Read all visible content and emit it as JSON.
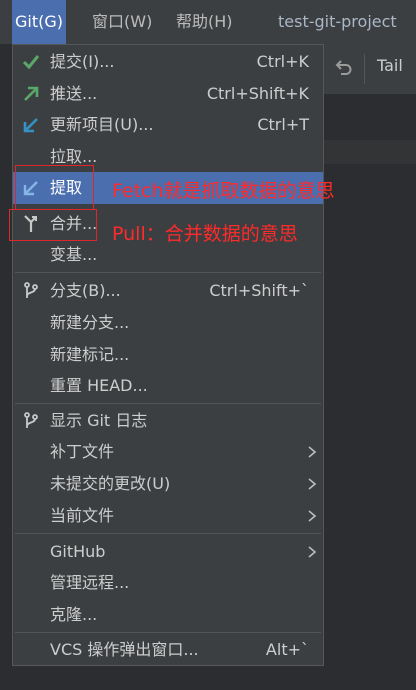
{
  "menubar": {
    "git": "Git(G)",
    "window": "窗口(W)",
    "help": "帮助(H)",
    "project": "test-git-project"
  },
  "toolbar": {
    "tail_label": "Tail"
  },
  "menu": {
    "commit": {
      "label": "提交(I)...",
      "shortcut": "Ctrl+K"
    },
    "push": {
      "label": "推送...",
      "shortcut": "Ctrl+Shift+K"
    },
    "update": {
      "label": "更新项目(U)...",
      "shortcut": "Ctrl+T"
    },
    "pull": {
      "label": "拉取..."
    },
    "fetch": {
      "label": "提取"
    },
    "merge": {
      "label": "合并..."
    },
    "rebase": {
      "label": "变基..."
    },
    "branches": {
      "label": "分支(B)...",
      "shortcut": "Ctrl+Shift+`"
    },
    "new_branch": {
      "label": "新建分支..."
    },
    "new_tag": {
      "label": "新建标记..."
    },
    "reset_head": {
      "label": "重置 HEAD..."
    },
    "show_log": {
      "label": "显示 Git 日志"
    },
    "patch": {
      "label": "补丁文件"
    },
    "uncommitted": {
      "label": "未提交的更改(U)"
    },
    "current_file": {
      "label": "当前文件"
    },
    "github": {
      "label": "GitHub"
    },
    "manage_remotes": {
      "label": "管理远程..."
    },
    "clone": {
      "label": "克隆..."
    },
    "vcs_popup": {
      "label": "VCS 操作弹出窗口...",
      "shortcut": "Alt+`"
    }
  },
  "annotations": {
    "fetch_note": "Fetch就是抓取数据的意思",
    "pull_note": "Pull：合并数据的意思"
  },
  "colors": {
    "selected": "#4b6eaf",
    "check_icon": "#59a869",
    "push_icon": "#59a869",
    "update_icon": "#3592c4",
    "annotation": "#ff2a2a"
  },
  "icons": {
    "commit": "check-icon",
    "push": "push-arrow-icon",
    "update": "update-arrow-icon",
    "fetch": "fetch-arrow-icon",
    "merge": "merge-icon",
    "branches": "branch-icon",
    "show_log": "git-log-icon",
    "submenu": "chevron-right-icon",
    "undo": "undo-icon"
  }
}
